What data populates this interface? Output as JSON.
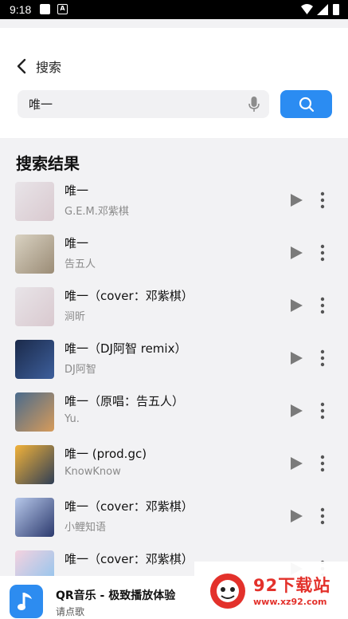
{
  "status_bar": {
    "time": "9:18"
  },
  "header": {
    "back_label": "搜索",
    "search_value": "唯一"
  },
  "results": {
    "title": "搜索结果",
    "items": [
      {
        "title": "唯一",
        "artist": "G.E.M.邓紫棋",
        "thumb_colors": [
          "#e8e4e8",
          "#d9c9cf"
        ]
      },
      {
        "title": "唯一",
        "artist": "告五人",
        "thumb_colors": [
          "#d9d2c2",
          "#9b8c76"
        ]
      },
      {
        "title": "唯一（cover：邓紫棋）",
        "artist": "涧昕",
        "thumb_colors": [
          "#e8e4e8",
          "#d9c9cf"
        ]
      },
      {
        "title": "唯一（DJ阿智 remix）",
        "artist": "DJ阿智",
        "thumb_colors": [
          "#1b2a4a",
          "#3d5f9c"
        ]
      },
      {
        "title": "唯一（原唱：告五人）",
        "artist": "Yu.",
        "thumb_colors": [
          "#4a6b8c",
          "#d79b5a"
        ]
      },
      {
        "title": "唯一 (prod.gc)",
        "artist": "KnowKnow",
        "thumb_colors": [
          "#f2b23a",
          "#2f3e55"
        ]
      },
      {
        "title": "唯一（cover：邓紫棋）",
        "artist": "小鲤知语",
        "thumb_colors": [
          "#b7c8ea",
          "#2c3a6e"
        ]
      },
      {
        "title": "唯一（cover：邓紫棋）",
        "artist": "",
        "thumb_colors": [
          "#f4d2df",
          "#88c3ef"
        ]
      }
    ]
  },
  "ad": {
    "title": "QR音乐 - 极致播放体验",
    "subtitle": "请点歌"
  },
  "watermark": {
    "name": "92下载站",
    "url": "www.xz92.com"
  },
  "colors": {
    "accent": "#2b8cf2",
    "watermark_red": "#e3312b"
  }
}
